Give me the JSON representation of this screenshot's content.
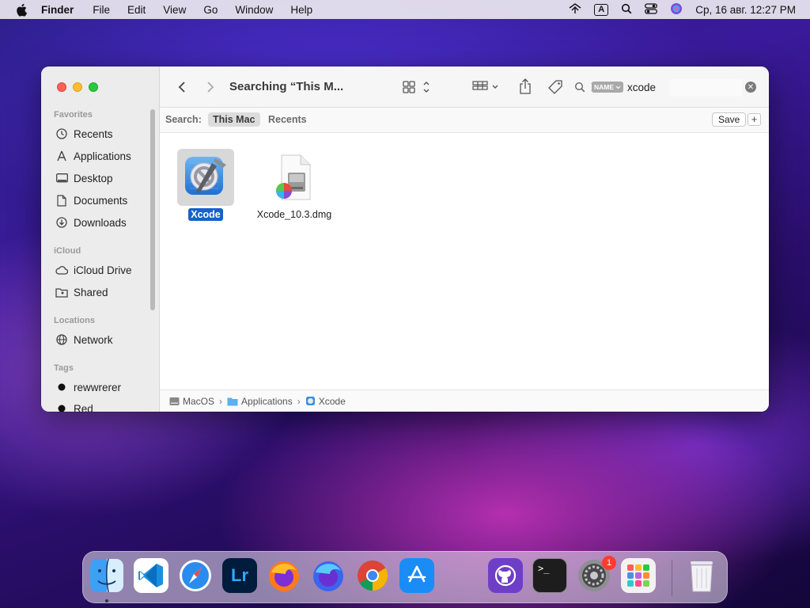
{
  "menubar": {
    "app_name": "Finder",
    "items": [
      "File",
      "Edit",
      "View",
      "Go",
      "Window",
      "Help"
    ],
    "keyboard_indicator": "A",
    "clock": "Ср, 16 авг.  12:27 PM"
  },
  "window": {
    "title": "Searching “This M...",
    "sidebar": {
      "sections": [
        {
          "heading": "Favorites",
          "items": [
            {
              "label": "Recents",
              "icon": "clock-icon"
            },
            {
              "label": "Applications",
              "icon": "applications-icon"
            },
            {
              "label": "Desktop",
              "icon": "desktop-icon"
            },
            {
              "label": "Documents",
              "icon": "document-icon"
            },
            {
              "label": "Downloads",
              "icon": "download-icon"
            }
          ]
        },
        {
          "heading": "iCloud",
          "items": [
            {
              "label": "iCloud Drive",
              "icon": "cloud-icon"
            },
            {
              "label": "Shared",
              "icon": "shared-folder-icon"
            }
          ]
        },
        {
          "heading": "Locations",
          "items": [
            {
              "label": "Network",
              "icon": "globe-icon"
            }
          ]
        },
        {
          "heading": "Tags",
          "items": [
            {
              "label": "rewwrerer",
              "icon": "tag-dot-icon"
            },
            {
              "label": "Red",
              "icon": "tag-dot-icon"
            }
          ]
        }
      ]
    },
    "search": {
      "token": "NAME",
      "query": "xcode"
    },
    "scopebar": {
      "label": "Search:",
      "this_mac": "This Mac",
      "recents": "Recents",
      "save": "Save",
      "add": "+"
    },
    "files": [
      {
        "name": "Xcode",
        "icon": "xcode-app-icon",
        "selected": true
      },
      {
        "name": "Xcode_10.3.dmg",
        "icon": "disk-image-icon",
        "selected": false
      }
    ],
    "path": [
      "MacOS",
      "Applications",
      "Xcode"
    ]
  },
  "dock": {
    "apps": [
      "Finder",
      "Visual Studio Code",
      "Safari",
      "Lightroom",
      "Firefox",
      "Firefox Developer Edition",
      "Chrome",
      "App Store",
      "GitHub Desktop",
      "Terminal",
      "System Preferences",
      "Launchpad",
      "Trash"
    ],
    "system_preferences_badge": "1"
  },
  "colors": {
    "selection": "#1761c9",
    "close": "#ff5f57",
    "minimize": "#febc2e",
    "zoom": "#28c840"
  }
}
